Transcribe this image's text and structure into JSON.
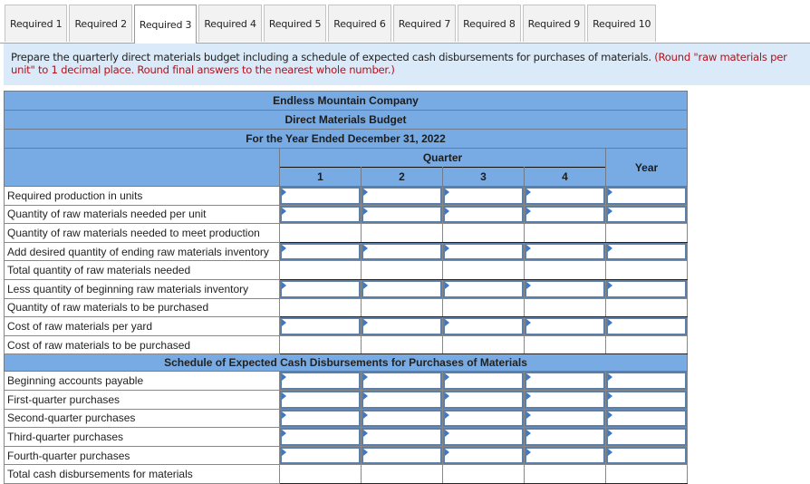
{
  "tabs": [
    {
      "label": "Required 1",
      "active": false
    },
    {
      "label": "Required 2",
      "active": false
    },
    {
      "label": "Required 3",
      "active": true
    },
    {
      "label": "Required 4",
      "active": false
    },
    {
      "label": "Required 5",
      "active": false
    },
    {
      "label": "Required 6",
      "active": false
    },
    {
      "label": "Required 7",
      "active": false
    },
    {
      "label": "Required 8",
      "active": false
    },
    {
      "label": "Required 9",
      "active": false
    },
    {
      "label": "Required 10",
      "active": false
    }
  ],
  "instructions": {
    "main": "Prepare the quarterly direct materials budget including a schedule of expected cash disbursements for purchases of materials. ",
    "note": "(Round \"raw materials per unit\" to 1 decimal place. Round final answers to the nearest whole number.)"
  },
  "budget": {
    "company": "Endless Mountain Company",
    "title": "Direct Materials Budget",
    "period": "For the Year Ended December 31, 2022",
    "quarter_header": "Quarter",
    "year_header": "Year",
    "quarters": [
      "1",
      "2",
      "3",
      "4"
    ],
    "rows": [
      {
        "label": "Required production in units",
        "input": true
      },
      {
        "label": "Quantity of raw materials needed per unit",
        "input": true
      },
      {
        "label": "Quantity of raw materials needed to meet production",
        "input": false
      },
      {
        "label": "Add desired quantity of ending raw materials inventory",
        "input": true
      },
      {
        "label": "Total quantity of raw materials needed",
        "input": false
      },
      {
        "label": "Less quantity of beginning raw materials inventory",
        "input": true
      },
      {
        "label": "Quantity of raw materials to be purchased",
        "input": false
      },
      {
        "label": "Cost of raw materials per yard",
        "input": true
      },
      {
        "label": "Cost of raw materials to be purchased",
        "input": false
      }
    ],
    "schedule_title": "Schedule of Expected Cash Disbursements for Purchases of Materials",
    "schedule_rows": [
      {
        "label": "Beginning accounts payable",
        "input": true
      },
      {
        "label": "First-quarter purchases",
        "input": true
      },
      {
        "label": "Second-quarter purchases",
        "input": true
      },
      {
        "label": "Third-quarter purchases",
        "input": true
      },
      {
        "label": "Fourth-quarter purchases",
        "input": true
      },
      {
        "label": "Total cash disbursements for materials",
        "input": false
      }
    ],
    "values": {
      "rows": [
        [
          "",
          "",
          "",
          "",
          ""
        ],
        [
          "",
          "",
          "",
          "",
          ""
        ],
        [
          "",
          "",
          "",
          "",
          ""
        ],
        [
          "",
          "",
          "",
          "",
          ""
        ],
        [
          "",
          "",
          "",
          "",
          ""
        ],
        [
          "",
          "",
          "",
          "",
          ""
        ],
        [
          "",
          "",
          "",
          "",
          ""
        ],
        [
          "",
          "",
          "",
          "",
          ""
        ],
        [
          "",
          "",
          "",
          "",
          ""
        ]
      ],
      "schedule_rows": [
        [
          "",
          "",
          "",
          "",
          ""
        ],
        [
          "",
          "",
          "",
          "",
          ""
        ],
        [
          "",
          "",
          "",
          "",
          ""
        ],
        [
          "",
          "",
          "",
          "",
          ""
        ],
        [
          "",
          "",
          "",
          "",
          ""
        ],
        [
          "",
          "",
          "",
          "",
          ""
        ]
      ]
    }
  }
}
